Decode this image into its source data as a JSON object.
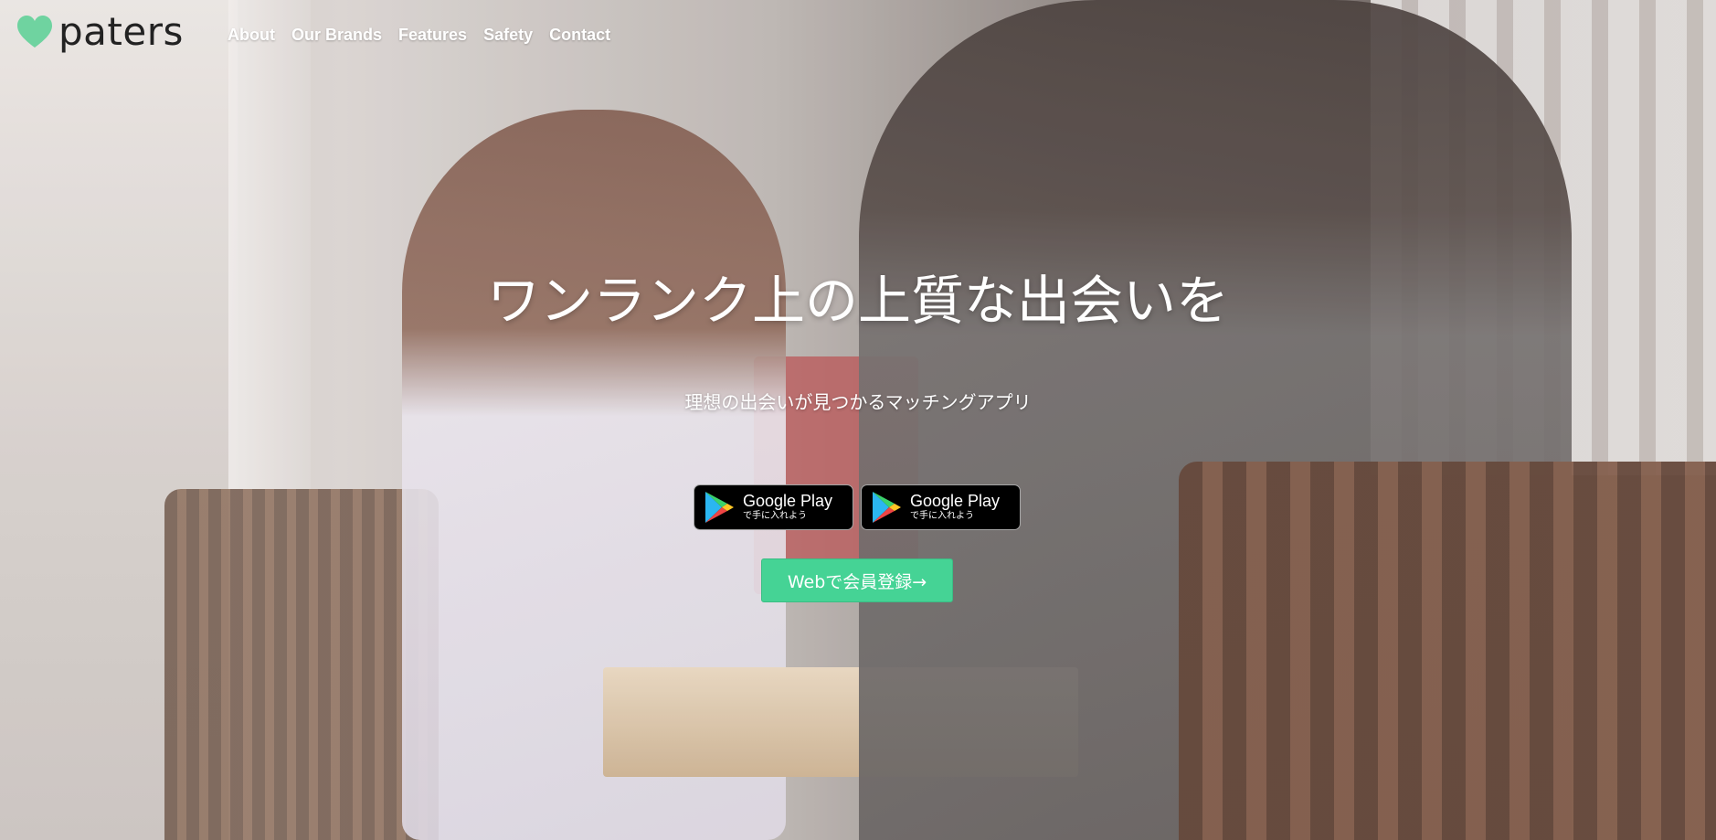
{
  "brand": {
    "name": "paters",
    "accent_color": "#6fd3a0",
    "logo_icon": "heart-icon"
  },
  "nav": {
    "items": [
      {
        "label": "About"
      },
      {
        "label": "Our Brands"
      },
      {
        "label": "Features"
      },
      {
        "label": "Safety"
      },
      {
        "label": "Contact"
      }
    ]
  },
  "hero": {
    "headline": "ワンランク上の上質な出会いを",
    "subheadline": "理想の出会いが見つかるマッチングアプリ",
    "store_badges": [
      {
        "title": "Google Play",
        "subtitle": "で手に入れよう",
        "icon": "google-play-icon"
      },
      {
        "title": "Google Play",
        "subtitle": "で手に入れよう",
        "icon": "google-play-icon"
      }
    ],
    "register_button": {
      "label": "Webで会員登録→",
      "color": "#45d395"
    }
  }
}
